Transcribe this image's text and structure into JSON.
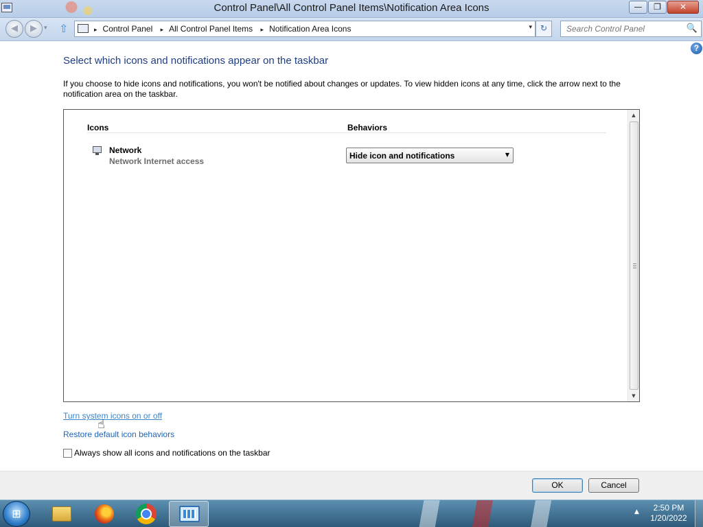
{
  "window": {
    "title": "Control Panel\\All Control Panel Items\\Notification Area Icons",
    "minimize_glyph": "—",
    "maximize_glyph": "❐",
    "close_glyph": "✕"
  },
  "navigation": {
    "back_glyph": "◀",
    "forward_glyph": "▶",
    "history_glyph": "▾",
    "up_glyph": "⇧",
    "breadcrumbs": [
      "Control Panel",
      "All Control Panel Items",
      "Notification Area Icons"
    ],
    "breadcrumb_separator": "▸",
    "dropdown_glyph": "▾",
    "refresh_glyph": "↻",
    "search_placeholder": "Search Control Panel",
    "search_glyph": "🔍"
  },
  "content": {
    "help_glyph": "?",
    "heading": "Select which icons and notifications appear on the taskbar",
    "description": "If you choose to hide icons and notifications, you won't be notified about changes or updates. To view hidden icons at any time, click the arrow next to the notification area on the taskbar.",
    "columns": {
      "icons": "Icons",
      "behaviors": "Behaviors"
    },
    "rows": [
      {
        "name": "Network",
        "subtitle": "Network  Internet access",
        "behavior": "Hide icon and notifications",
        "icon": "network-monitor-icon"
      }
    ],
    "select_arrow": "▼",
    "scroll_up_glyph": "▲",
    "scroll_down_glyph": "▼",
    "links": {
      "system_icons": "Turn system icons on or off",
      "restore": "Restore default icon behaviors"
    },
    "cursor_glyph": "☝",
    "checkbox_label": "Always show all icons and notifications on the taskbar",
    "checkbox_checked": false
  },
  "footer": {
    "ok": "OK",
    "cancel": "Cancel"
  },
  "taskbar": {
    "start_glyph": "⊞",
    "items": [
      "windows-explorer",
      "firefox",
      "chrome",
      "control-panel"
    ],
    "tray_arrow": "▲",
    "time": "2:50 PM",
    "date": "1/20/2022"
  },
  "colors": {
    "link": "#1e64b4",
    "heading": "#1e3d82",
    "taskbar": "#2e5a7a"
  }
}
